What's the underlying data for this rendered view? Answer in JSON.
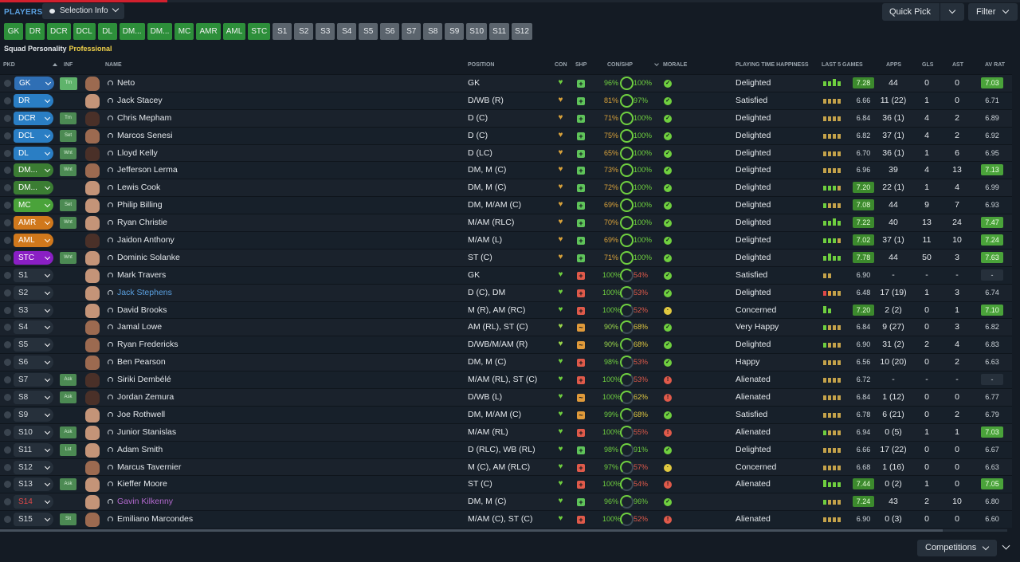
{
  "header": {
    "title": "PLAYERS",
    "selection_info": "Selection Info",
    "quick_pick": "Quick Pick",
    "filter": "Filter"
  },
  "position_buttons": [
    "GK",
    "DR",
    "DCR",
    "DCL",
    "DL",
    "DM...",
    "DM...",
    "MC",
    "AMR",
    "AML",
    "STC",
    "S1",
    "S2",
    "S3",
    "S4",
    "S5",
    "S6",
    "S7",
    "S8",
    "S9",
    "S10",
    "S11",
    "S12"
  ],
  "personality": {
    "label": "Squad Personality",
    "value": "Professional"
  },
  "columns": {
    "pkd": "PKD",
    "inf": "INF",
    "name": "NAME",
    "position": "POSITION",
    "con": "CON",
    "shp": "SHP",
    "con_shp": "CON/SHP",
    "morale": "MORALE",
    "pth": "PLAYING TIME HAPPINESS",
    "form": "LAST 5 GAMES",
    "apps": "APPS",
    "gls": "GLS",
    "ast": "AST",
    "avrat": "AV RAT"
  },
  "players": [
    {
      "role": "GK",
      "inf": "Trn",
      "name": "Neto",
      "pos": "GK",
      "con": "96%",
      "shp": "100%",
      "pth": "Delighted",
      "form": "7.28",
      "apps": "44",
      "gls": "0",
      "ast": "0",
      "avr": "7.03"
    },
    {
      "role": "DR",
      "inf": "",
      "name": "Jack Stacey",
      "pos": "D/WB (R)",
      "con": "81%",
      "shp": "97%",
      "pth": "Satisfied",
      "form": "6.66",
      "apps": "11 (22)",
      "gls": "1",
      "ast": "0",
      "avr": "6.71"
    },
    {
      "role": "DCR",
      "inf": "Trn",
      "name": "Chris Mepham",
      "pos": "D (C)",
      "con": "71%",
      "shp": "100%",
      "pth": "Delighted",
      "form": "6.84",
      "apps": "36 (1)",
      "gls": "4",
      "ast": "2",
      "avr": "6.89"
    },
    {
      "role": "DCL",
      "inf": "Set",
      "name": "Marcos Senesi",
      "pos": "D (C)",
      "con": "75%",
      "shp": "100%",
      "pth": "Delighted",
      "form": "6.82",
      "apps": "37 (1)",
      "gls": "4",
      "ast": "2",
      "avr": "6.92"
    },
    {
      "role": "DL",
      "inf": "Wnt",
      "name": "Lloyd Kelly",
      "pos": "D (LC)",
      "con": "65%",
      "shp": "100%",
      "pth": "Delighted",
      "form": "6.70",
      "apps": "36 (1)",
      "gls": "1",
      "ast": "6",
      "avr": "6.95"
    },
    {
      "role": "DM...",
      "inf": "Wnt",
      "name": "Jefferson Lerma",
      "pos": "DM, M (C)",
      "con": "73%",
      "shp": "100%",
      "pth": "Delighted",
      "form": "6.96",
      "apps": "39",
      "gls": "4",
      "ast": "13",
      "avr": "7.13"
    },
    {
      "role": "DM...",
      "inf": "",
      "name": "Lewis Cook",
      "pos": "DM, M (C)",
      "con": "72%",
      "shp": "100%",
      "pth": "Delighted",
      "form": "7.20",
      "apps": "22 (1)",
      "gls": "1",
      "ast": "4",
      "avr": "6.99"
    },
    {
      "role": "MC",
      "inf": "Set",
      "name": "Philip Billing",
      "pos": "DM, M/AM (C)",
      "con": "69%",
      "shp": "100%",
      "pth": "Delighted",
      "form": "7.08",
      "apps": "44",
      "gls": "9",
      "ast": "7",
      "avr": "6.93"
    },
    {
      "role": "AMR",
      "inf": "Wnt",
      "name": "Ryan Christie",
      "pos": "M/AM (RLC)",
      "con": "70%",
      "shp": "100%",
      "pth": "Delighted",
      "form": "7.22",
      "apps": "40",
      "gls": "13",
      "ast": "24",
      "avr": "7.47"
    },
    {
      "role": "AML",
      "inf": "",
      "name": "Jaidon Anthony",
      "pos": "M/AM (L)",
      "con": "69%",
      "shp": "100%",
      "pth": "Delighted",
      "form": "7.02",
      "apps": "37 (1)",
      "gls": "11",
      "ast": "10",
      "avr": "7.24"
    },
    {
      "role": "STC",
      "inf": "Wnt",
      "name": "Dominic Solanke",
      "pos": "ST (C)",
      "con": "71%",
      "shp": "100%",
      "pth": "Delighted",
      "form": "7.78",
      "apps": "44",
      "gls": "50",
      "ast": "3",
      "avr": "7.63"
    },
    {
      "role": "S1",
      "inf": "",
      "name": "Mark Travers",
      "pos": "GK",
      "con": "100%",
      "shp": "54%",
      "pth": "Satisfied",
      "form": "6.90",
      "apps": "-",
      "gls": "-",
      "ast": "-",
      "avr": "-"
    },
    {
      "role": "S2",
      "inf": "",
      "name": "Jack Stephens",
      "pos": "D (C), DM",
      "con": "100%",
      "shp": "53%",
      "pth": "Delighted",
      "form": "6.48",
      "apps": "17 (19)",
      "gls": "1",
      "ast": "3",
      "avr": "6.74"
    },
    {
      "role": "S3",
      "inf": "",
      "name": "David Brooks",
      "pos": "M (R), AM (RC)",
      "con": "100%",
      "shp": "52%",
      "pth": "Concerned",
      "form": "7.20",
      "apps": "2 (2)",
      "gls": "0",
      "ast": "1",
      "avr": "7.10"
    },
    {
      "role": "S4",
      "inf": "",
      "name": "Jamal Lowe",
      "pos": "AM (RL), ST (C)",
      "con": "90%",
      "shp": "68%",
      "pth": "Very Happy",
      "form": "6.84",
      "apps": "9 (27)",
      "gls": "0",
      "ast": "3",
      "avr": "6.82"
    },
    {
      "role": "S5",
      "inf": "",
      "name": "Ryan Fredericks",
      "pos": "D/WB/M/AM (R)",
      "con": "90%",
      "shp": "68%",
      "pth": "Delighted",
      "form": "6.90",
      "apps": "31 (2)",
      "gls": "2",
      "ast": "4",
      "avr": "6.83"
    },
    {
      "role": "S6",
      "inf": "",
      "name": "Ben Pearson",
      "pos": "DM, M (C)",
      "con": "98%",
      "shp": "53%",
      "pth": "Happy",
      "form": "6.56",
      "apps": "10 (20)",
      "gls": "0",
      "ast": "2",
      "avr": "6.63"
    },
    {
      "role": "S7",
      "inf": "Ask",
      "name": "Siriki Dembélé",
      "pos": "M/AM (RL), ST (C)",
      "con": "100%",
      "shp": "53%",
      "pth": "Alienated",
      "form": "6.72",
      "apps": "-",
      "gls": "-",
      "ast": "-",
      "avr": "-"
    },
    {
      "role": "S8",
      "inf": "Ask",
      "name": "Jordan Zemura",
      "pos": "D/WB (L)",
      "con": "100%",
      "shp": "62%",
      "pth": "Alienated",
      "form": "6.84",
      "apps": "1 (12)",
      "gls": "0",
      "ast": "0",
      "avr": "6.77"
    },
    {
      "role": "S9",
      "inf": "",
      "name": "Joe Rothwell",
      "pos": "DM, M/AM (C)",
      "con": "99%",
      "shp": "68%",
      "pth": "Satisfied",
      "form": "6.78",
      "apps": "6 (21)",
      "gls": "0",
      "ast": "2",
      "avr": "6.79"
    },
    {
      "role": "S10",
      "inf": "Ask",
      "name": "Junior Stanislas",
      "pos": "M/AM (RL)",
      "con": "100%",
      "shp": "55%",
      "pth": "Alienated",
      "form": "6.94",
      "apps": "0 (5)",
      "gls": "1",
      "ast": "1",
      "avr": "7.03"
    },
    {
      "role": "S11",
      "inf": "Lst",
      "name": "Adam Smith",
      "pos": "D (RLC), WB (RL)",
      "con": "98%",
      "shp": "91%",
      "pth": "Delighted",
      "form": "6.66",
      "apps": "17 (22)",
      "gls": "0",
      "ast": "0",
      "avr": "6.67"
    },
    {
      "role": "S12",
      "inf": "",
      "name": "Marcus Tavernier",
      "pos": "M (C), AM (RLC)",
      "con": "97%",
      "shp": "57%",
      "pth": "Concerned",
      "form": "6.68",
      "apps": "1 (16)",
      "gls": "0",
      "ast": "0",
      "avr": "6.63"
    },
    {
      "role": "S13",
      "inf": "Ask",
      "name": "Kieffer Moore",
      "pos": "ST (C)",
      "con": "100%",
      "shp": "54%",
      "pth": "Alienated",
      "form": "7.44",
      "apps": "0 (2)",
      "gls": "1",
      "ast": "0",
      "avr": "7.05"
    },
    {
      "role": "S14",
      "inf": "",
      "name": "Gavin Kilkenny",
      "pos": "DM, M (C)",
      "con": "96%",
      "shp": "96%",
      "pth": "",
      "form": "7.24",
      "apps": "43",
      "gls": "2",
      "ast": "10",
      "avr": "6.80"
    },
    {
      "role": "S15",
      "inf": "Slt",
      "name": "Emiliano Marcondes",
      "pos": "M/AM (C), ST (C)",
      "con": "100%",
      "shp": "52%",
      "pth": "Alienated",
      "form": "6.90",
      "apps": "0 (3)",
      "gls": "0",
      "ast": "0",
      "avr": "6.60"
    }
  ],
  "footer": {
    "competitions": "Competitions"
  },
  "colors": {
    "accent": "#5aa0e0",
    "good": "#6fcf3f",
    "bad": "#e04848",
    "warn": "#e09a3a"
  }
}
